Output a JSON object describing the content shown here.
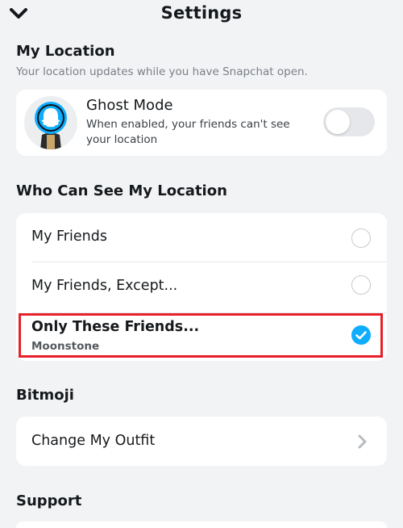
{
  "header": {
    "title": "Settings",
    "back_icon": "chevron-down-icon"
  },
  "my_location": {
    "title": "My Location",
    "subtitle": "Your location updates while you have Snapchat open.",
    "ghost_mode": {
      "label": "Ghost Mode",
      "description_line1": "When enabled, your friends can't see",
      "description_line2": "your location",
      "enabled": false,
      "avatar_icon": "ghost-bitmoji-avatar-icon"
    }
  },
  "who_can_see": {
    "title": "Who Can See My Location",
    "options": [
      {
        "label": "My Friends",
        "selected": false
      },
      {
        "label": "My Friends, Except...",
        "selected": false
      },
      {
        "label": "Only These Friends...",
        "sublabel": "Moonstone",
        "selected": true
      }
    ]
  },
  "bitmoji": {
    "title": "Bitmoji",
    "change_outfit": "Change My Outfit",
    "chevron_icon": "chevron-right-icon"
  },
  "support": {
    "title": "Support"
  },
  "colors": {
    "accent": "#0fadff",
    "highlight": "#e8202a",
    "background": "#f2f3f5",
    "card": "#ffffff"
  }
}
